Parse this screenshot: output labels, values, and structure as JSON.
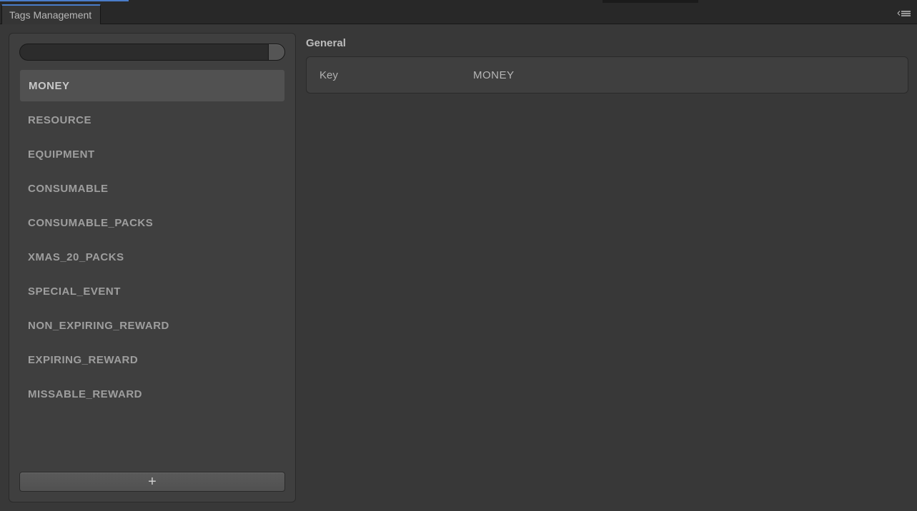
{
  "tab": {
    "title": "Tags Management"
  },
  "sidebar": {
    "search": {
      "placeholder": ""
    },
    "items": [
      {
        "label": "MONEY",
        "selected": true
      },
      {
        "label": "RESOURCE",
        "selected": false
      },
      {
        "label": "EQUIPMENT",
        "selected": false
      },
      {
        "label": "CONSUMABLE",
        "selected": false
      },
      {
        "label": "CONSUMABLE_PACKS",
        "selected": false
      },
      {
        "label": "XMAS_20_PACKS",
        "selected": false
      },
      {
        "label": "SPECIAL_EVENT",
        "selected": false
      },
      {
        "label": "NON_EXPIRING_REWARD",
        "selected": false
      },
      {
        "label": "EXPIRING_REWARD",
        "selected": false
      },
      {
        "label": "MISSABLE_REWARD",
        "selected": false
      }
    ],
    "add_label": "+"
  },
  "details": {
    "section_title": "General",
    "key_label": "Key",
    "key_value": "MONEY"
  }
}
